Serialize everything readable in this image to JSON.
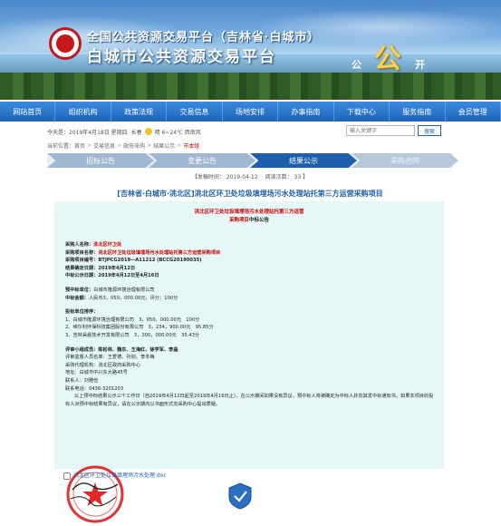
{
  "banner": {
    "brand_top": "全国公共资源交易平台（吉林省·白城市）",
    "brand_main": "白城市公共资源交易平台",
    "slogan_1": "公",
    "slogan_2": "公",
    "slogan_3": "开"
  },
  "nav": {
    "items": [
      "网站首页",
      "组织机构",
      "政策法规",
      "交易信息",
      "场地安排",
      "办事指南",
      "下载中心",
      "服务指南",
      "会员管理"
    ]
  },
  "info": {
    "date": "今天是：2019年4月18日 星期四",
    "weather_city": "长春",
    "weather": "晴 6~24℃ 西南风",
    "search_placeholder": "输入关键字",
    "search_button": "搜索"
  },
  "breadcrumb": {
    "label": "当前位置：",
    "items": [
      "首页",
      "交易信息",
      "政府采购",
      "结果公示"
    ],
    "current": "市本级"
  },
  "steps": [
    "招标公告",
    "变更公告",
    "结果公示",
    "采购合同"
  ],
  "publish": {
    "time_label": "【发稿时间：",
    "time": "2019-04-12",
    "views_label": "阅读次数：",
    "views": "33",
    "end": "】"
  },
  "project_title": "[吉林省·白城市·洮北区]洮北区环卫处垃圾填埋场污水处理站托第三方运营采购项目",
  "doc": {
    "head_1": "洮北区环卫处垃圾填埋场污水处理站托第三方运营",
    "head_2": "采购项目",
    "head_2b": "中标公告",
    "buyer_label": "采购人名称：",
    "buyer": "洮北区环卫处",
    "project_label": "采购项目名称：",
    "project": "洮北区环卫处垃圾填埋场污水处理站托第三方运营采购项目",
    "number_label": "采购项目编号：",
    "number": "BTJPCG2019—A11212 (BCCG20190035)",
    "date1_label": "结果确定日期：",
    "date1": "2019年4月12日",
    "date2_label": "中标公示日期：",
    "date2": "2019年4月12日至4月16日",
    "winner_label": "预中标单位：",
    "winner": "白城市隆源环境治理有限公司",
    "amount_label": "中标金额：",
    "amount": "人民币3，050，000.00元，评分：100分",
    "rank_label": "投标单位排序：",
    "rank_1": "1、白城市隆源环境治理有限公司　3，050，000.00元　100分",
    "rank_2": "2、缔尔利环保科技集团股份有限公司　3，234，900.00元　95.85分",
    "rank_3": "3、吉林昊晨技术开发有限公司　3，300，000.00元　35.43分",
    "committee_label": "评审小组成员：",
    "committee": "陈松林、魏东、王海红、徐学军、李晶",
    "supervisor_label": "评审监督人员名单：",
    "supervisor": "王爱德、孙剑、李冬梅",
    "agency_label": "采购代理机构：",
    "agency": "洮北区政府采购中心",
    "address_label": "地址：",
    "address": "白城市中兴东大路45号",
    "contact_label": "联系人：",
    "contact": "刘雅俭",
    "phone_label": "联系电话：",
    "phone": "0436-3201203",
    "notice": "以上预中标结果公示三个工作日（自2019年4月12日起至2019年4月16日止）。在公示期间如果没有异议，预中标人将被确定为中标人并向其发中标通知书。如果本项目的投标人对预中标结果有异议，请在公示期内以书面形式向采购中心提出质疑。"
  },
  "attachment": "洮北区环卫处垃圾填埋场污水处理.doc"
}
